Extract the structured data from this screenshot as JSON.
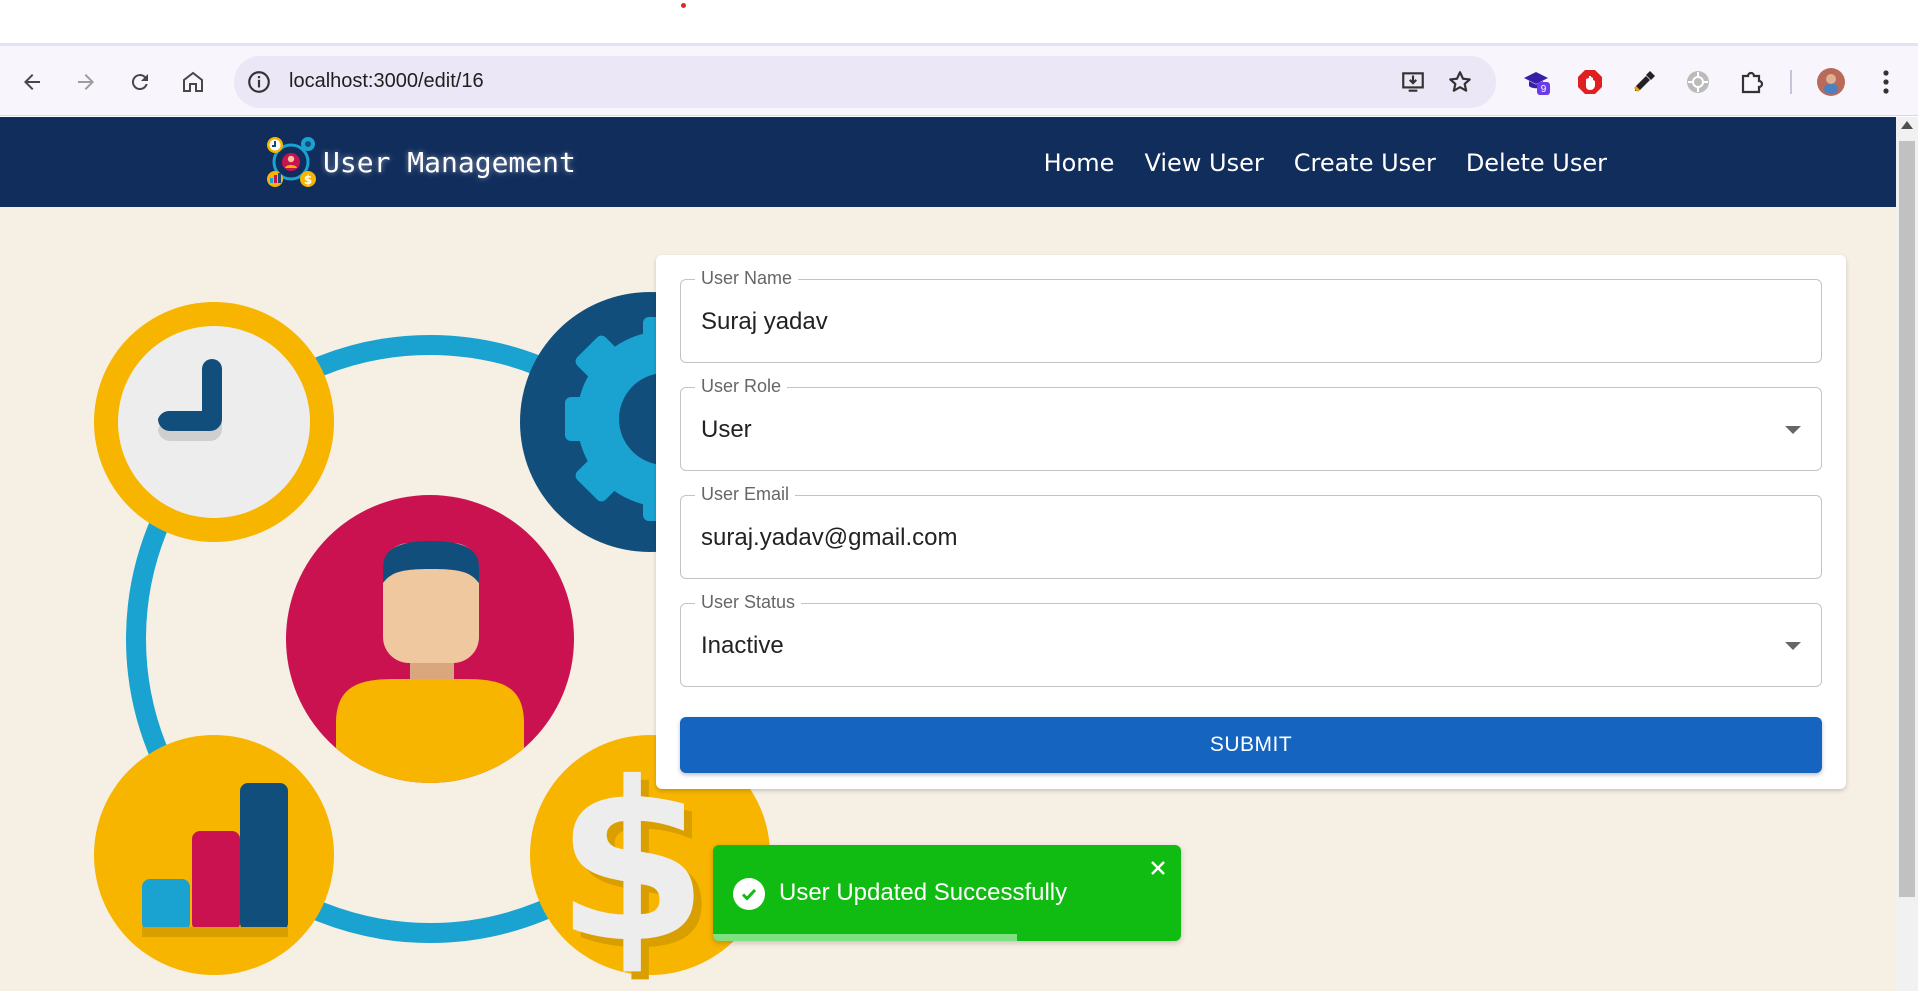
{
  "browser": {
    "url": "localhost:3000/edit/16",
    "extension_badge": "9"
  },
  "app": {
    "brand_title": "User Management",
    "nav": [
      "Home",
      "View User",
      "Create User",
      "Delete User"
    ]
  },
  "form": {
    "name_label": "User Name",
    "name_value": "Suraj yadav",
    "role_label": "User Role",
    "role_value": "User",
    "email_label": "User Email",
    "email_value": "suraj.yadav@gmail.com",
    "status_label": "User Status",
    "status_value": "Inactive",
    "submit_label": "SUBMIT"
  },
  "toast": {
    "message": "User Updated Successfully",
    "progress": 0.65
  },
  "colors": {
    "appbar": "#112d5c",
    "submit": "#1565c0",
    "toast": "#11bc12",
    "background": "#f6efe4"
  }
}
